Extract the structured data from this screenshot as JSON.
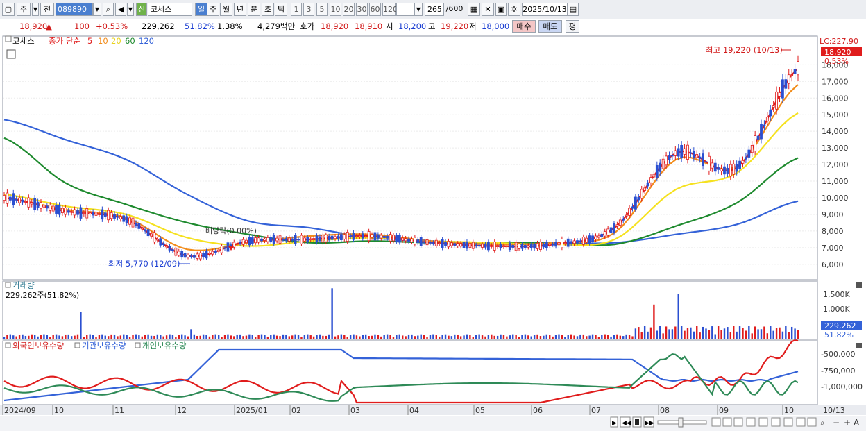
{
  "toolbar": {
    "period": "주",
    "name_btn": "전",
    "code": "089890",
    "credit_badge": "신",
    "stock_name": "코세스",
    "tf_buttons": [
      "일",
      "주",
      "월",
      "년",
      "분",
      "초",
      "틱"
    ],
    "tf_selected": "일",
    "num_buttons": [
      "1",
      "3",
      "5",
      "10",
      "20",
      "30",
      "60",
      "120"
    ],
    "count": "265",
    "count_total": "/600",
    "date": "2025/10/13"
  },
  "quote": {
    "price": "18,920",
    "arrow": "▲",
    "change": "100",
    "change_pct": "+0.53%",
    "volume": "229,262",
    "vol_ratio": "51.82%",
    "turnover": "1.38%",
    "amount": "4,279백만",
    "ask_label": "호가",
    "ask": "18,920",
    "bid": "18,910",
    "open_label": "시",
    "open": "18,200",
    "high_label": "고",
    "high": "19,220",
    "low_label": "저",
    "low": "18,000",
    "buy": "매수",
    "sell": "매도",
    "eval": "평"
  },
  "price_pane": {
    "legend": {
      "name": "코세스",
      "label": "종가 단순",
      "ma": [
        "5",
        "10",
        "20",
        "60",
        "120"
      ]
    },
    "lc": "LC:227.90",
    "price_tag": "18,920",
    "pct_tag": "0.53%",
    "high_annot": "최고 19,220 (10/13)",
    "low_annot": "최저 5,770 (12/09)",
    "dividend": "배당락(0.00%)"
  },
  "volume_pane": {
    "title": "거래량",
    "summary": "229,262주(51.82%)",
    "tag_value": "229,262",
    "tag_pct": "51.82%"
  },
  "holdings_pane": {
    "titles": [
      "외국인보유수량",
      "기관보유수량",
      "개인보유수량"
    ]
  },
  "xaxis": {
    "labels": [
      "2024/09",
      "10",
      "11",
      "12",
      "2025/01",
      "02",
      "03",
      "04",
      "05",
      "06",
      "07",
      "08",
      "09",
      "10"
    ],
    "end_label": "10/13"
  },
  "colors": {
    "ma5": "#e01c1c",
    "ma10": "#f28c1a",
    "ma20": "#f5e11f",
    "ma60": "#1e8a2e",
    "ma120": "#3462d8",
    "up": "#e01c1c",
    "down": "#2a4fd1",
    "foreign": "#e01c1c",
    "inst": "#3462d8",
    "indiv": "#2e8a57"
  },
  "chart_data": [
    {
      "type": "line",
      "title": "코세스 종가 단순",
      "x": [
        "2024/09",
        "2024/10",
        "2024/11",
        "2024/12",
        "2025/01",
        "2025/02",
        "2025/03",
        "2025/04",
        "2025/05",
        "2025/06",
        "2025/07",
        "2025/08",
        "2025/09",
        "2025/10/13"
      ],
      "yticks": [
        6000,
        7000,
        8000,
        9000,
        10000,
        11000,
        12000,
        13000,
        14000,
        15000,
        16000,
        17000,
        18000
      ],
      "ylim": [
        5200,
        19600
      ],
      "series": [
        {
          "name": "5",
          "values": [
            10000,
            9200,
            8700,
            6500,
            7400,
            7500,
            7700,
            7300,
            7100,
            7200,
            8200,
            12700,
            11800,
            17800
          ]
        },
        {
          "name": "10",
          "values": [
            10000,
            9300,
            8800,
            6900,
            7300,
            7700,
            7800,
            7400,
            7200,
            7300,
            7900,
            12300,
            11900,
            16800
          ]
        },
        {
          "name": "20",
          "values": [
            10200,
            9500,
            9000,
            7600,
            7100,
            7400,
            7600,
            7400,
            7300,
            7200,
            7500,
            10500,
            11500,
            15100
          ]
        },
        {
          "name": "60",
          "values": [
            13600,
            10900,
            9600,
            8500,
            7800,
            7300,
            7400,
            7300,
            7300,
            7300,
            7200,
            8300,
            9700,
            12400
          ]
        },
        {
          "name": "120",
          "values": [
            14700,
            13500,
            12300,
            10200,
            8600,
            8200,
            7600,
            7400,
            7300,
            7300,
            7300,
            7800,
            8400,
            9800
          ]
        }
      ],
      "high": {
        "value": 19220,
        "date": "10/13"
      },
      "low": {
        "value": 5770,
        "date": "12/09"
      },
      "last": 18920
    },
    {
      "type": "bar",
      "title": "거래량",
      "yticks": [
        "500K",
        "1,000K",
        "1,500K"
      ],
      "ylim": [
        0,
        1800000
      ],
      "last": 229262
    },
    {
      "type": "line",
      "title": "외국인보유수량 / 기관보유수량 / 개인보유수량",
      "yticks": [
        "-500,000",
        "-750,000",
        "-1,000,000"
      ]
    }
  ]
}
